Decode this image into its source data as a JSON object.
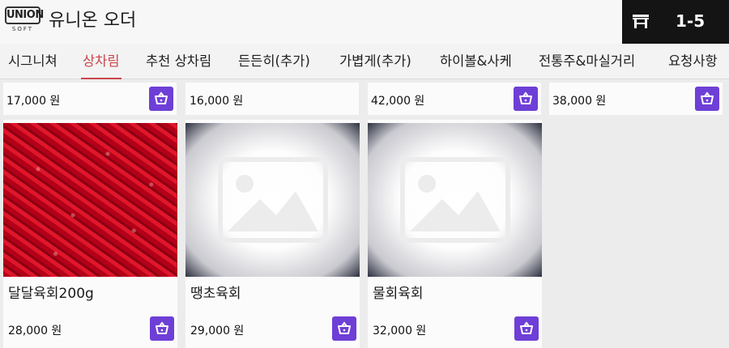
{
  "header": {
    "logo_top": "UNION",
    "logo_bottom": "SOFT",
    "app_title": "유니온 오더",
    "table_icon": "table-icon",
    "table_number": "1-5",
    "colors": {
      "header_dark": "#141414",
      "accent": "#c9464d",
      "cart": "#6e3fd6"
    }
  },
  "tabs": [
    {
      "label": "시그니쳐",
      "active": false
    },
    {
      "label": "상차림",
      "active": true
    },
    {
      "label": "추천 상차림",
      "active": false
    },
    {
      "label": "든든히(추가)",
      "active": false
    },
    {
      "label": "가볍게(추가)",
      "active": false
    },
    {
      "label": "하이볼&사케",
      "active": false
    },
    {
      "label": "전통주&마실거리",
      "active": false
    },
    {
      "label": "요청사항",
      "active": false
    }
  ],
  "top_row": [
    {
      "price": "17,000 원",
      "icon": "cart-icon"
    },
    {
      "price": "16,000 원",
      "icon": "cart-icon"
    },
    {
      "price": "42,000 원",
      "icon": "cart-icon"
    },
    {
      "price": "38,000 원",
      "icon": "cart-icon"
    }
  ],
  "products": [
    {
      "name": "달달육회200g",
      "price": "28,000 원",
      "image": "meat-photo",
      "icon": "cart-icon"
    },
    {
      "name": "땡초육회",
      "price": "29,000 원",
      "image": "image-placeholder-icon",
      "icon": "cart-icon"
    },
    {
      "name": "물회육회",
      "price": "32,000 원",
      "image": "image-placeholder-icon",
      "icon": "cart-icon"
    }
  ]
}
